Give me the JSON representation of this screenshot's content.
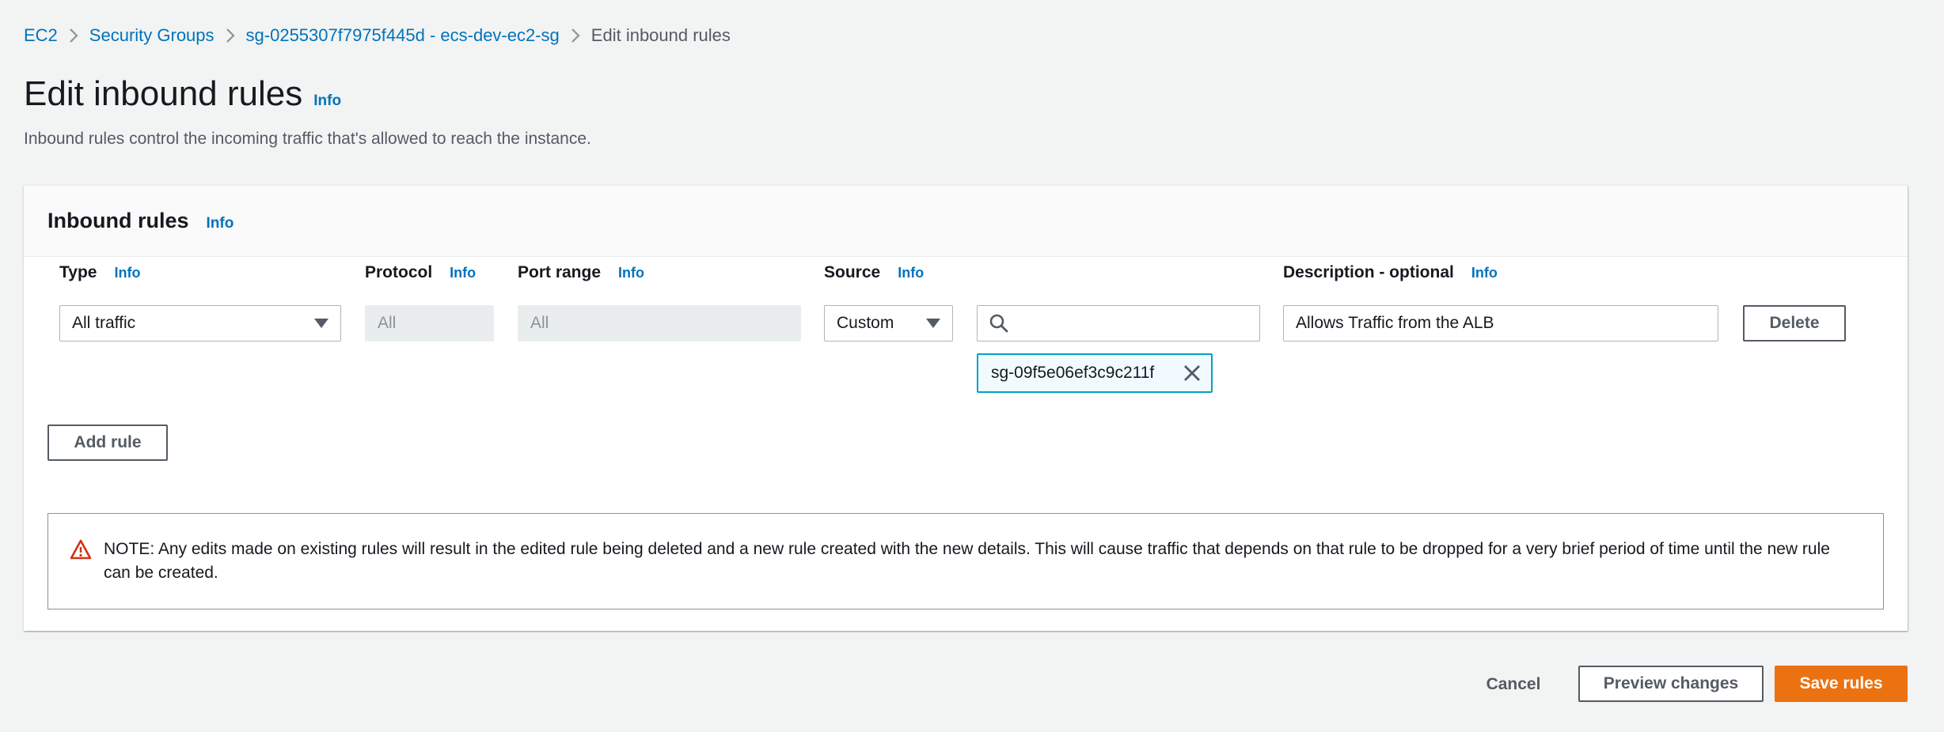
{
  "breadcrumb": {
    "items": [
      "EC2",
      "Security Groups",
      "sg-0255307f7975f445d - ecs-dev-ec2-sg"
    ],
    "current": "Edit inbound rules"
  },
  "page": {
    "title": "Edit inbound rules",
    "info": "Info",
    "description": "Inbound rules control the incoming traffic that's allowed to reach the instance."
  },
  "panel": {
    "title": "Inbound rules",
    "info": "Info",
    "columns": {
      "type": "Type",
      "protocol": "Protocol",
      "port_range": "Port range",
      "source": "Source",
      "description": "Description - optional"
    },
    "info_label": "Info",
    "rule": {
      "type_value": "All traffic",
      "protocol_value": "All",
      "port_range_value": "All",
      "source_type": "Custom",
      "source_search_value": "",
      "source_token": "sg-09f5e06ef3c9c211f",
      "description_value": "Allows Traffic from the ALB",
      "delete_label": "Delete"
    },
    "add_rule_label": "Add rule",
    "note": "NOTE: Any edits made on existing rules will result in the edited rule being deleted and a new rule created with the new details. This will cause traffic that depends on that rule to be dropped for a very brief period of time until the new rule can be created."
  },
  "footer": {
    "cancel": "Cancel",
    "preview": "Preview changes",
    "save": "Save rules"
  },
  "colors": {
    "link": "#0073bb",
    "primary_button": "#ec7211",
    "warning_icon": "#d13212",
    "token_border": "#00a1c9"
  }
}
